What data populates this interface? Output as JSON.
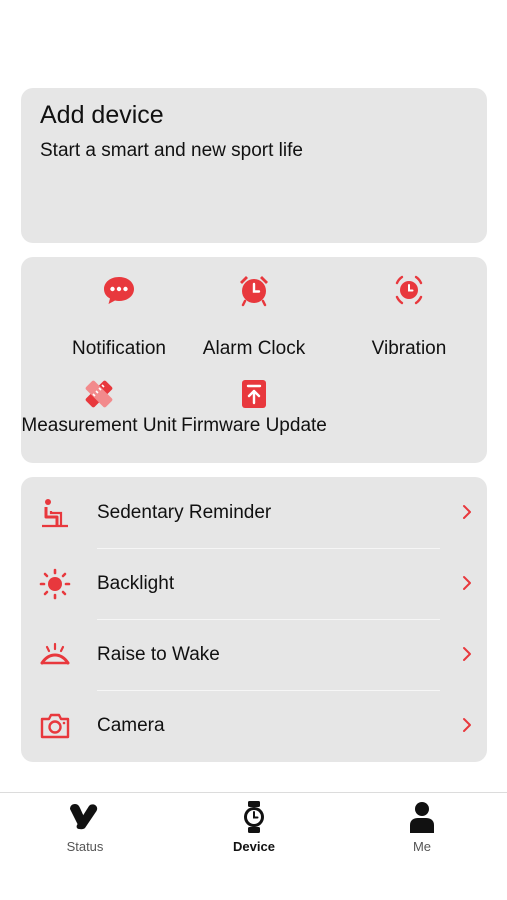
{
  "add_device": {
    "title": "Add device",
    "subtitle": "Start a smart and new sport life"
  },
  "features": [
    {
      "label": "Notification",
      "icon": "chat-bubble-icon"
    },
    {
      "label": "Alarm Clock",
      "icon": "alarm-clock-icon"
    },
    {
      "label": "Vibration",
      "icon": "vibration-icon"
    },
    {
      "label": "Measurement Unit",
      "icon": "ruler-icon"
    },
    {
      "label": "Firmware Update",
      "icon": "firmware-update-icon"
    }
  ],
  "settings": [
    {
      "label": "Sedentary Reminder",
      "icon": "sedentary-icon"
    },
    {
      "label": "Backlight",
      "icon": "sun-icon"
    },
    {
      "label": "Raise to Wake",
      "icon": "raise-wake-icon"
    },
    {
      "label": "Camera",
      "icon": "camera-icon"
    }
  ],
  "tabs": [
    {
      "label": "Status",
      "icon": "status-icon",
      "active": false
    },
    {
      "label": "Device",
      "icon": "watch-icon",
      "active": true
    },
    {
      "label": "Me",
      "icon": "person-icon",
      "active": false
    }
  ],
  "colors": {
    "accent": "#e8383d",
    "card_background": "#e6e6e6",
    "page_background": "#ffffff"
  }
}
